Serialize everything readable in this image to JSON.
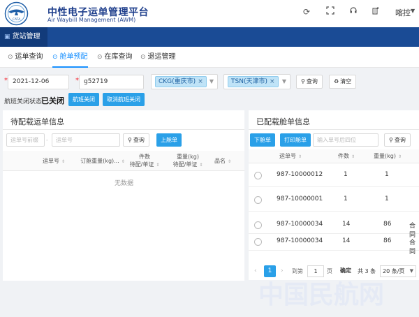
{
  "header": {
    "brand_title": "中性电子运单管理平台",
    "brand_subtitle": "Air Waybill Management (AWM)",
    "logo_text": "CATA",
    "user_name": "喀控"
  },
  "nav": {
    "active_label": "货站管理"
  },
  "tabs": [
    {
      "label": "运单查询",
      "icon": "search-icon"
    },
    {
      "label": "舱单预配",
      "icon": "manifest-icon",
      "active": true
    },
    {
      "label": "在库查询",
      "icon": "warehouse-icon"
    },
    {
      "label": "退运管理",
      "icon": "return-icon"
    }
  ],
  "filter": {
    "date_value": "2021-12-06",
    "flight_value": "g52719",
    "origin_tag": "CKG(重庆市)",
    "dest_tag": "TSN(天津市)",
    "query_label": "查询",
    "clear_label": "清空",
    "close_status_label": "航班关闭状态",
    "close_status_value": "已关闭",
    "close_flight_label": "航班关闭",
    "cancel_close_label": "取消航班关闭"
  },
  "left_panel": {
    "title": "待配载运单信息",
    "prefix_placeholder": "运单号前缀",
    "waybill_placeholder": "运单号",
    "query_label": "查询",
    "load_button": "上舱单",
    "columns": [
      "运单号",
      "订舱重量(kg)...",
      "件数\n待配/单证",
      "重量(kg)\n待配/单证",
      "品名"
    ],
    "empty_text": "无数据"
  },
  "right_panel": {
    "title": "已配载舱单信息",
    "unload_button": "下舱单",
    "print_button": "打印舱单",
    "placement_placeholder": "输入单号后四位",
    "query_label": "查询",
    "columns": [
      "运单号",
      "件数",
      "重量(kg)"
    ],
    "rows": [
      {
        "waybill": "987-10000012",
        "pieces": "1",
        "weight": "1",
        "extra": ""
      },
      {
        "waybill": "987-10000001",
        "pieces": "1",
        "weight": "1",
        "extra": ""
      },
      {
        "waybill": "987-10000034",
        "pieces": "14",
        "weight": "86",
        "extra": "合同"
      },
      {
        "waybill": "987-10000034",
        "pieces": "14",
        "weight": "86",
        "extra": "合同"
      }
    ]
  },
  "pagination": {
    "current_page": "1",
    "goto_label": "到第",
    "goto_value": "1",
    "page_unit": "页",
    "confirm_label": "确定",
    "total_text": "共 3 条",
    "page_size": "20 条/页"
  },
  "watermark_text": "中国民航网",
  "colors": {
    "brand": "#1a4b95",
    "accent": "#2aa0e8",
    "tab_active": "#1890ff"
  }
}
